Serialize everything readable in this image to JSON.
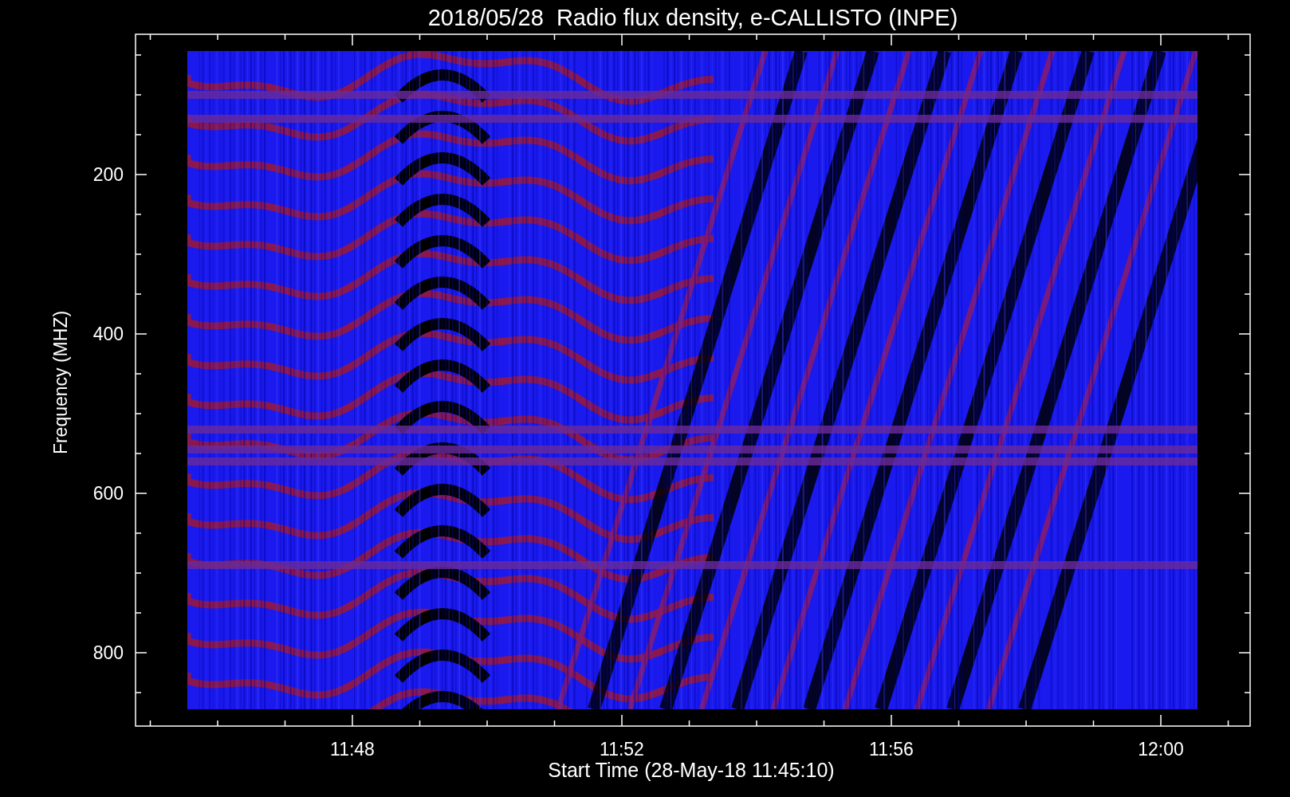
{
  "title": "2018/05/28  Radio flux density, e-CALLISTO (INPE)",
  "y_axis": {
    "label": "Frequency (MHZ)",
    "ticks": [
      "200",
      "400",
      "600",
      "800"
    ]
  },
  "x_axis": {
    "label": "Start Time (28-May-18 11:45:10)",
    "ticks": [
      "11:48",
      "11:52",
      "11:56",
      "12:00"
    ]
  }
}
